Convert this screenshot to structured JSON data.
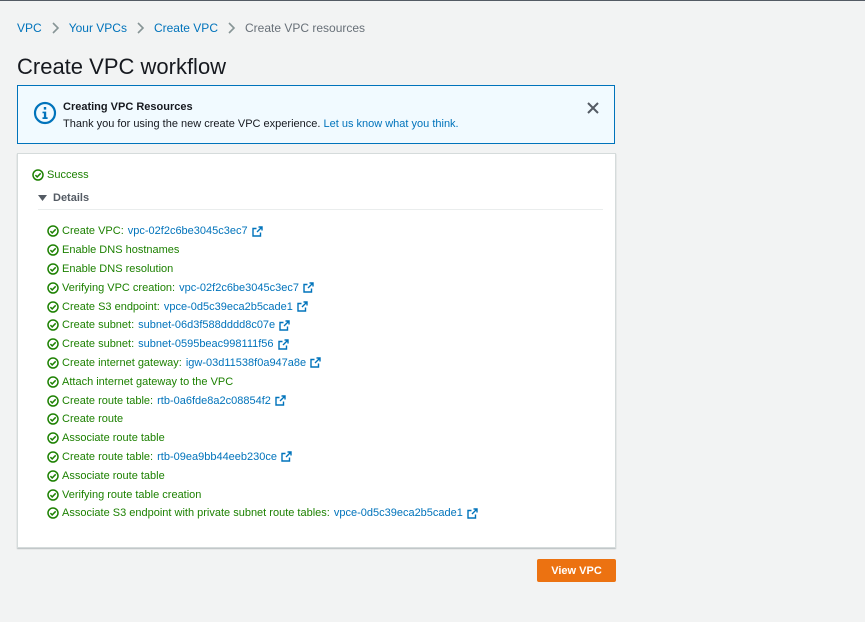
{
  "breadcrumb": {
    "items": [
      {
        "label": "VPC"
      },
      {
        "label": "Your VPCs"
      },
      {
        "label": "Create VPC"
      }
    ],
    "current": "Create VPC resources"
  },
  "page_title": "Create VPC workflow",
  "flash": {
    "title": "Creating VPC Resources",
    "message": "Thank you for using the new create VPC experience.",
    "link": "Let us know what you think.",
    "icon": "info-icon"
  },
  "status": {
    "label": "Success",
    "details_label": "Details"
  },
  "steps": [
    {
      "text": "Create VPC:",
      "link": "vpc-02f2c6be3045c3ec7"
    },
    {
      "text": "Enable DNS hostnames"
    },
    {
      "text": "Enable DNS resolution"
    },
    {
      "text": "Verifying VPC creation:",
      "link": "vpc-02f2c6be3045c3ec7"
    },
    {
      "text": "Create S3 endpoint:",
      "link": "vpce-0d5c39eca2b5cade1"
    },
    {
      "text": "Create subnet:",
      "link": "subnet-06d3f588dddd8c07e"
    },
    {
      "text": "Create subnet:",
      "link": "subnet-0595beac998111f56"
    },
    {
      "text": "Create internet gateway:",
      "link": "igw-03d11538f0a947a8e"
    },
    {
      "text": "Attach internet gateway to the VPC"
    },
    {
      "text": "Create route table:",
      "link": "rtb-0a6fde8a2c08854f2"
    },
    {
      "text": "Create route"
    },
    {
      "text": "Associate route table"
    },
    {
      "text": "Create route table:",
      "link": "rtb-09ea9bb44eeb230ce"
    },
    {
      "text": "Associate route table"
    },
    {
      "text": "Verifying route table creation"
    },
    {
      "text": "Associate S3 endpoint with private subnet route tables:",
      "link": "vpce-0d5c39eca2b5cade1"
    }
  ],
  "actions": {
    "view_vpc": "View VPC"
  },
  "colors": {
    "success": "#1d8102",
    "link": "#0073bb",
    "primary_button": "#ec7211",
    "info_border": "#0073bb"
  }
}
